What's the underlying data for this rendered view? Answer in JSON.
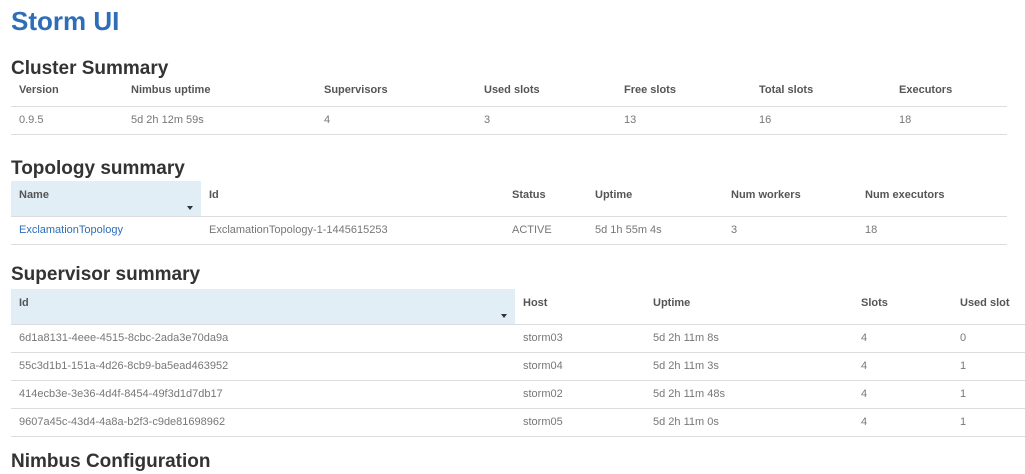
{
  "app": {
    "title": "Storm UI"
  },
  "cluster": {
    "heading": "Cluster Summary",
    "columns": [
      "Version",
      "Nimbus uptime",
      "Supervisors",
      "Used slots",
      "Free slots",
      "Total slots",
      "Executors"
    ],
    "row": [
      "0.9.5",
      "5d 2h 12m 59s",
      "4",
      "3",
      "13",
      "16",
      "18"
    ]
  },
  "topology": {
    "heading": "Topology summary",
    "columns": [
      "Name",
      "Id",
      "Status",
      "Uptime",
      "Num workers",
      "Num executors"
    ],
    "row": [
      "ExclamationTopology",
      "ExclamationTopology-1-1445615253",
      "ACTIVE",
      "5d 1h 55m 4s",
      "3",
      "18"
    ]
  },
  "supervisor": {
    "heading": "Supervisor summary",
    "columns": [
      "Id",
      "Host",
      "Uptime",
      "Slots",
      "Used slot"
    ],
    "rows": [
      [
        "6d1a8131-4eee-4515-8cbc-2ada3e70da9a",
        "storm03",
        "5d 2h 11m 8s",
        "4",
        "0"
      ],
      [
        "55c3d1b1-151a-4d26-8cb9-ba5ead463952",
        "storm04",
        "5d 2h 11m 3s",
        "4",
        "1"
      ],
      [
        "414ecb3e-3e36-4d4f-8454-49f3d1d7db17",
        "storm02",
        "5d 2h 11m 48s",
        "4",
        "1"
      ],
      [
        "9607a45c-43d4-4a8a-b2f3-c9de81698962",
        "storm05",
        "5d 2h 11m 0s",
        "4",
        "1"
      ]
    ]
  },
  "next_section": {
    "heading": "Nimbus Configuration"
  }
}
